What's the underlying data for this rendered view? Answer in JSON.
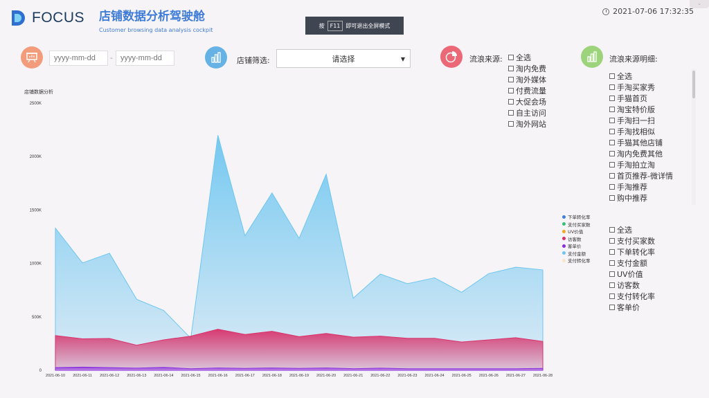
{
  "header": {
    "logo_text": "FOCUS",
    "title": "店铺数据分析驾驶舱",
    "subtitle": "Customer browsing data analysis cockpit",
    "fullscreen_hint_pre": "按",
    "fullscreen_hint_key": "F11",
    "fullscreen_hint_post": "即可退出全屏模式",
    "datetime": "2021-07-06 17:32:35"
  },
  "filters": {
    "date_start_placeholder": "yyyy-mm-dd",
    "date_end_placeholder": "yyyy-mm-dd",
    "date_separator": "-",
    "store_label": "店铺筛选:",
    "store_select_value": "请选择",
    "source_label": "流浪来源:",
    "source_options": [
      "全选",
      "淘内免费",
      "淘外媒体",
      "付费流量",
      "大促会场",
      "自主访问",
      "淘外网站"
    ],
    "detail_label": "流浪来源明细:",
    "detail_options": [
      "全选",
      "手淘买家秀",
      "手猫首页",
      "淘宝特价版",
      "手淘扫一扫",
      "手淘找相似",
      "手猫其他店铺",
      "淘内免费其他",
      "手淘拍立淘",
      "首页推荐-微详情",
      "手淘推荐",
      "购中推荐"
    ],
    "metric_options": [
      "全选",
      "支付买家数",
      "下单转化率",
      "支付金额",
      "UV价值",
      "访客数",
      "支付转化率",
      "客单价"
    ]
  },
  "colors": {
    "accent": "#3f7cd8",
    "icon_orange": "#f39c7b",
    "icon_blue": "#66b2e4",
    "icon_red": "#eb6876",
    "icon_green": "#9dd37b"
  },
  "icons": {
    "store_filter": "bar-chart-icon",
    "date_filter": "presentation-board-icon",
    "source_filter": "pie-chart-icon",
    "detail_filter": "bar-chart-icon",
    "clock": "clock-icon"
  },
  "chart_data": {
    "type": "area",
    "title": "店铺数据分析",
    "categories": [
      "2021-06-10",
      "2021-06-11",
      "2021-06-12",
      "2021-06-13",
      "2021-06-14",
      "2021-06-15",
      "2021-06-16",
      "2021-06-17",
      "2021-06-18",
      "2021-06-19",
      "2021-06-20",
      "2021-06-21",
      "2021-06-22",
      "2021-06-23",
      "2021-06-24",
      "2021-06-25",
      "2021-06-26",
      "2021-06-27",
      "2021-06-28"
    ],
    "ylim": [
      0,
      2500000
    ],
    "y_ticks": [
      "0",
      "500K",
      "1000K",
      "1500K",
      "2000K",
      "2500K"
    ],
    "grid": false,
    "legend_position": "right",
    "series": [
      {
        "name": "下单转化率",
        "color": "#3e7fe0",
        "values": [
          0,
          0,
          0,
          0,
          0,
          0,
          0,
          0,
          0,
          0,
          0,
          0,
          0,
          0,
          0,
          0,
          0,
          0,
          0
        ]
      },
      {
        "name": "支付买家数",
        "color": "#37c178",
        "values": [
          0,
          0,
          0,
          0,
          0,
          0,
          0,
          0,
          0,
          0,
          0,
          0,
          0,
          0,
          0,
          0,
          0,
          0,
          0
        ]
      },
      {
        "name": "UV价值",
        "color": "#f5a623",
        "values": [
          0,
          0,
          0,
          0,
          0,
          0,
          0,
          0,
          0,
          0,
          0,
          0,
          0,
          0,
          0,
          0,
          0,
          0,
          0
        ]
      },
      {
        "name": "访客数",
        "color": "#d9316a",
        "values": [
          325000,
          295000,
          298000,
          235000,
          285000,
          320000,
          385000,
          335000,
          365000,
          315000,
          345000,
          310000,
          320000,
          300000,
          300000,
          265000,
          285000,
          305000,
          270000
        ]
      },
      {
        "name": "客单价",
        "color": "#8a2be2",
        "values": [
          25000,
          30000,
          25000,
          20000,
          28000,
          15000,
          22000,
          18000,
          22000,
          18000,
          22000,
          15000,
          20000,
          15000,
          15000,
          15000,
          15000,
          15000,
          18000
        ]
      },
      {
        "name": "支付金额",
        "color": "#6ec6f0",
        "values": [
          1330000,
          1005000,
          1095000,
          665000,
          560000,
          300000,
          2200000,
          1260000,
          1660000,
          1235000,
          1835000,
          675000,
          900000,
          810000,
          865000,
          730000,
          905000,
          965000,
          940000
        ]
      },
      {
        "name": "支付转化率",
        "color": "#fbe3c6",
        "values": [
          0,
          0,
          0,
          0,
          0,
          0,
          0,
          0,
          0,
          0,
          0,
          0,
          0,
          0,
          0,
          0,
          0,
          0,
          0
        ]
      }
    ]
  }
}
